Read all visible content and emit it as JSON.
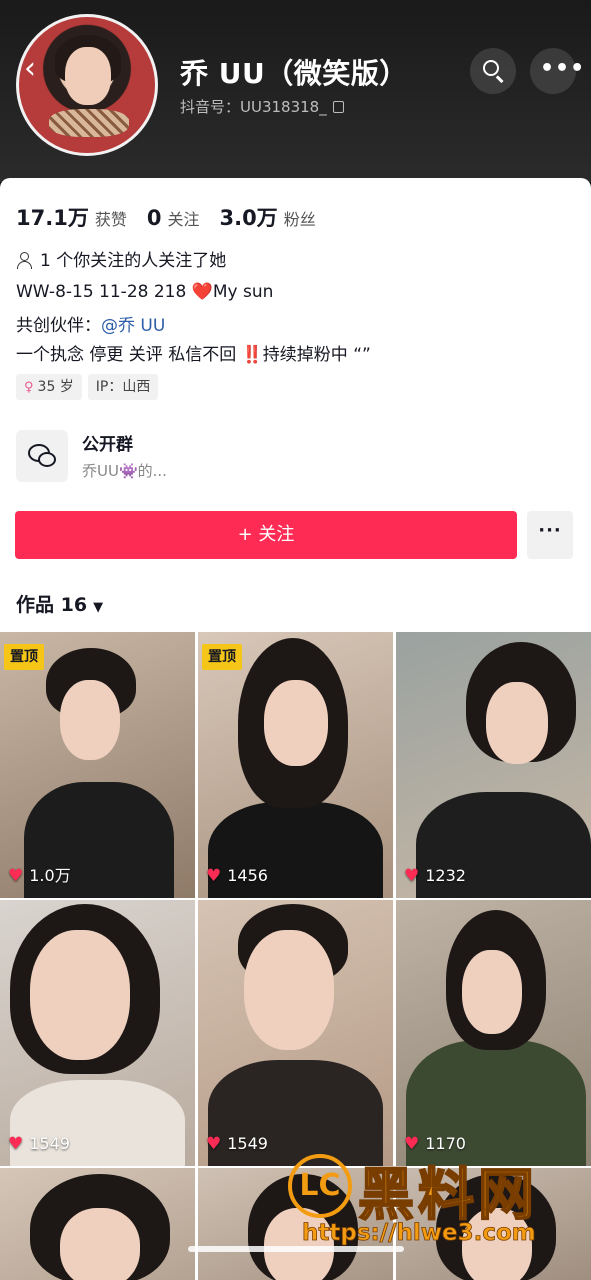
{
  "header": {
    "title": "乔 UU（微笑版）",
    "handle": "抖音号：UU318318_"
  },
  "stats": [
    {
      "num": "17.1万",
      "label": "获赞"
    },
    {
      "num": "0",
      "label": "关注"
    },
    {
      "num": "3.0万",
      "label": "粉丝"
    }
  ],
  "mutual": "1 个你关注的人关注了她",
  "bio": {
    "line1_pre": "WW-8-15 11-28  218 ",
    "line1_heart": "❤️",
    "line1_post": "My sun",
    "line2_label": "共创伙伴：",
    "line2_link": "@乔 UU",
    "line3_pre": "一个执念 停更 关评 私信不回 ",
    "line3_bang": "‼️",
    "line3_post": "持续掉粉中 “”"
  },
  "tags": {
    "age": "35 岁",
    "ip": "IP：山西"
  },
  "group": {
    "title": "公开群",
    "subtitle": "乔UU👾的..."
  },
  "actions": {
    "follow": "+ 关注",
    "more": "···"
  },
  "works": {
    "label": "作品 16"
  },
  "videos": [
    {
      "likes": "1.0万",
      "pinned": "置顶"
    },
    {
      "likes": "1456",
      "pinned": "置顶"
    },
    {
      "likes": "1232",
      "pinned": ""
    },
    {
      "likes": "1549",
      "pinned": ""
    },
    {
      "likes": "1549",
      "pinned": ""
    },
    {
      "likes": "1170",
      "pinned": ""
    }
  ],
  "watermark": {
    "logo": "LC",
    "text": "黑料网",
    "url": "https://hlwe3.com"
  },
  "colors": {
    "accent": "#fe2c55",
    "pin": "#f5c518"
  }
}
